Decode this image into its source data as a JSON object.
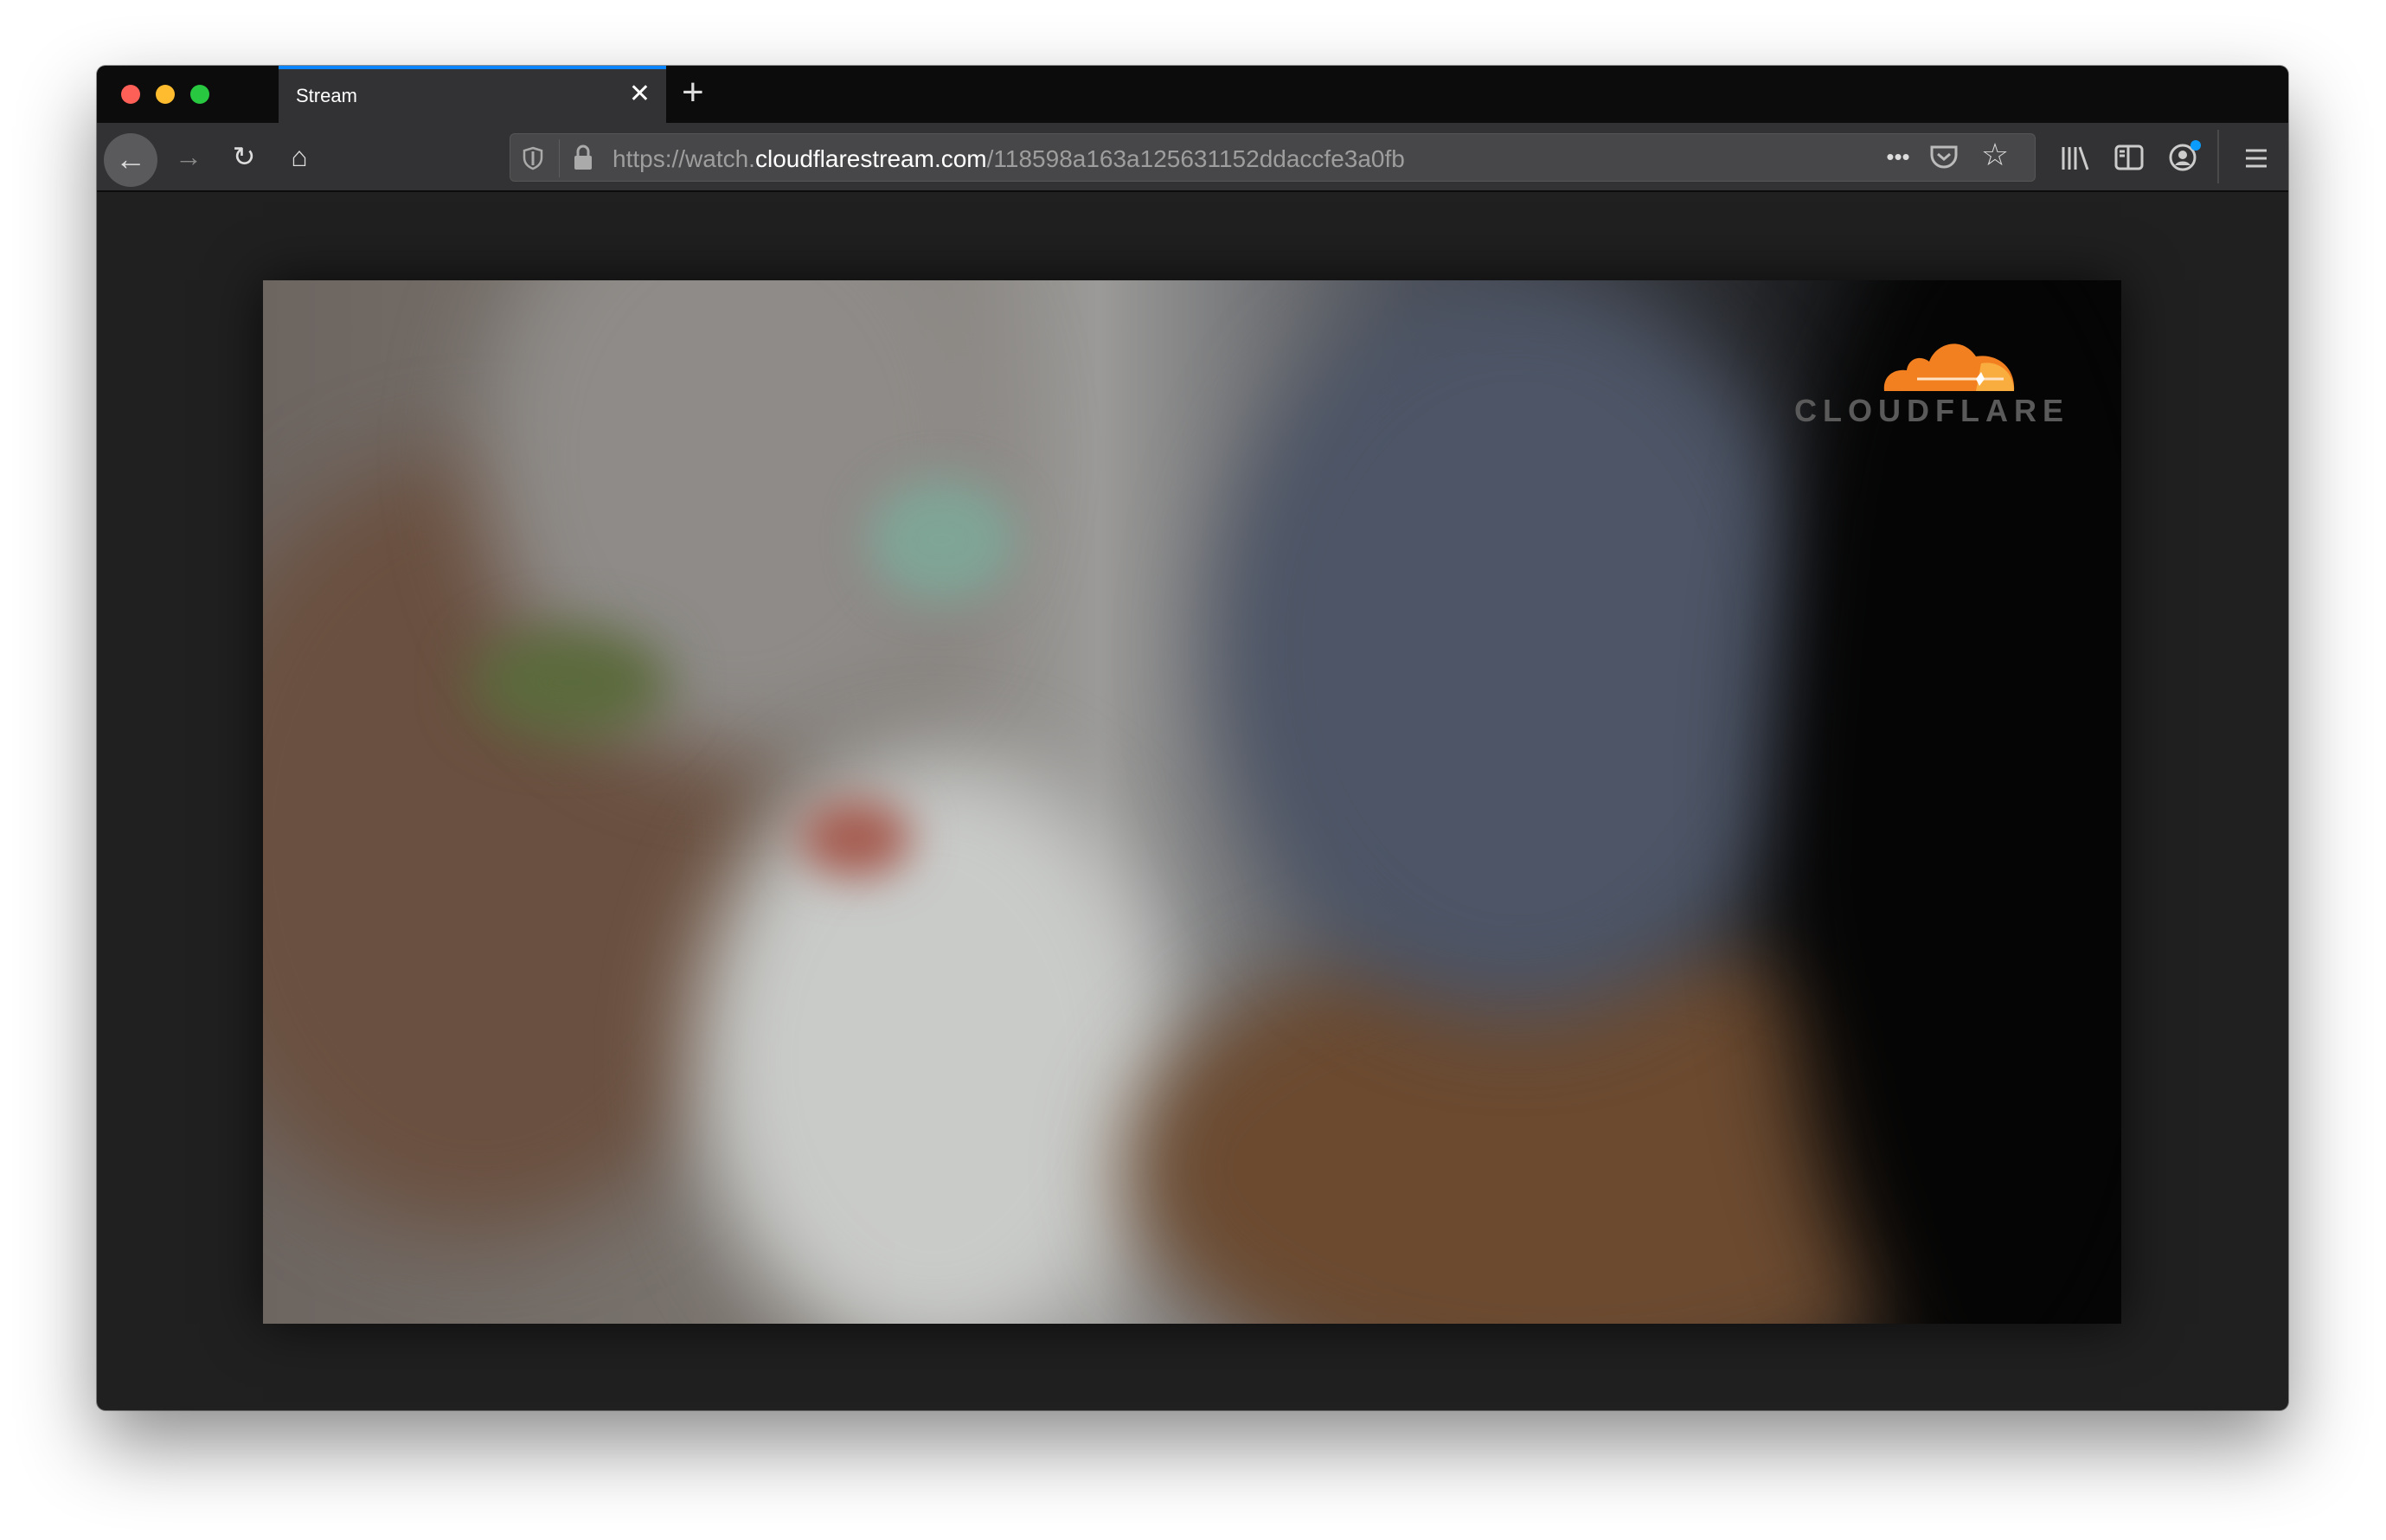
{
  "browser": {
    "tab": {
      "title": "Stream"
    },
    "url": {
      "prefix": "https://watch.",
      "domain": "cloudflarestream.com",
      "path": "/118598a163a125631152ddaccfe3a0fb"
    },
    "icons": [
      "back-icon",
      "forward-icon",
      "reload-icon",
      "home-icon",
      "shield-icon",
      "lock-icon",
      "more-icon",
      "pocket-icon",
      "star-icon",
      "library-icon",
      "sidebar-icon",
      "account-icon",
      "menu-icon"
    ],
    "colors": {
      "tab_accent": "#0a84ff",
      "notification": "#0a9dff"
    }
  },
  "video": {
    "logo_text": "CLOUDFLARE",
    "logo_color": "#f38020"
  }
}
